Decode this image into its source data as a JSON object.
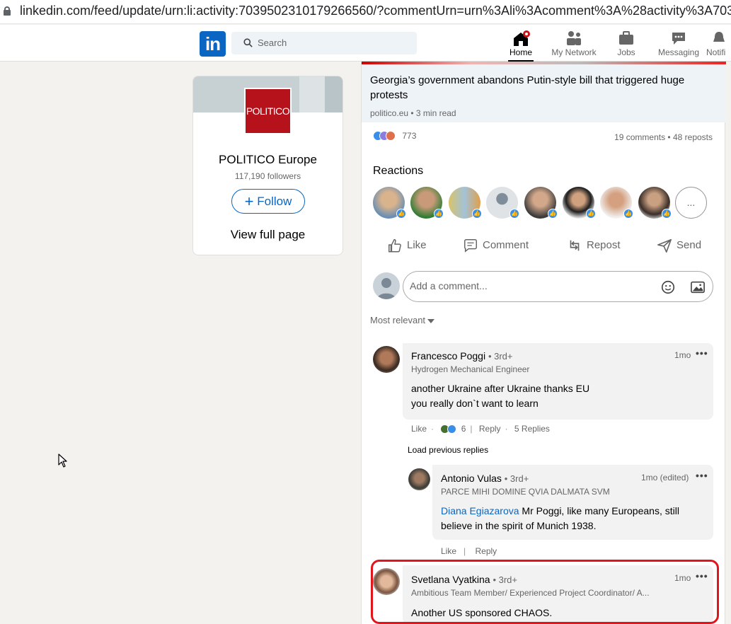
{
  "browser": {
    "url": "linkedin.com/feed/update/urn:li:activity:7039502310179266560/?commentUrn=urn%3Ali%3Acomment%3A%28activity%3A703950"
  },
  "nav": {
    "logo": "in",
    "search_placeholder": "Search",
    "items": [
      {
        "label": "Home",
        "icon": "home-icon",
        "active": true
      },
      {
        "label": "My Network",
        "icon": "network-icon"
      },
      {
        "label": "Jobs",
        "icon": "briefcase-icon"
      },
      {
        "label": "Messaging",
        "icon": "messaging-icon"
      },
      {
        "label": "Notifi",
        "icon": "bell-icon"
      }
    ]
  },
  "company": {
    "logo_text": "POLITICO",
    "name": "POLITICO Europe",
    "followers": "117,190 followers",
    "follow_label": "Follow",
    "view_full_label": "View full page"
  },
  "article": {
    "title": "Georgia’s government abandons Putin-style bill that triggered huge protests",
    "meta": "politico.eu • 3 min read"
  },
  "social": {
    "reaction_count": "773",
    "comments_reposts": "19 comments • 48 reposts"
  },
  "reactions": {
    "title": "Reactions",
    "more": "..."
  },
  "actions": {
    "like": "Like",
    "comment": "Comment",
    "repost": "Repost",
    "send": "Send"
  },
  "comment_box": {
    "placeholder": "Add a comment..."
  },
  "sort": {
    "label": "Most relevant"
  },
  "comments": [
    {
      "name": "Francesco Poggi",
      "degree": "• 3rd+",
      "headline": "Hydrogen Mechanical Engineer",
      "time": "1mo",
      "text_line1": "another Ukraine after Ukraine thanks EU",
      "text_line2": "you really don`t want to learn",
      "like": "Like",
      "reaction_count": "6",
      "reply": "Reply",
      "replies": "5 Replies"
    }
  ],
  "load_previous": "Load previous replies",
  "reply": {
    "name": "Antonio Vulas",
    "degree": "• 3rd+",
    "headline": "PARCE MIHI DOMINE QVIA DALMATA SVM",
    "time": "1mo (edited)",
    "mention": "Diana Egiazarova",
    "text_rest": " Mr Poggi, like many Europeans, still",
    "text_line2": "believe in the spirit of Munich 1938.",
    "like": "Like",
    "reply": "Reply"
  },
  "highlighted_comment": {
    "name": "Svetlana Vyatkina",
    "degree": "• 3rd+",
    "headline": "Ambitious Team Member/ Experienced Project Coordinator/ A...",
    "time": "1mo",
    "text": "Another US sponsored CHAOS."
  },
  "colors": {
    "linkedin_blue": "#0a66c2",
    "politico_red": "#b5121b",
    "highlight_red": "#e0161c"
  }
}
